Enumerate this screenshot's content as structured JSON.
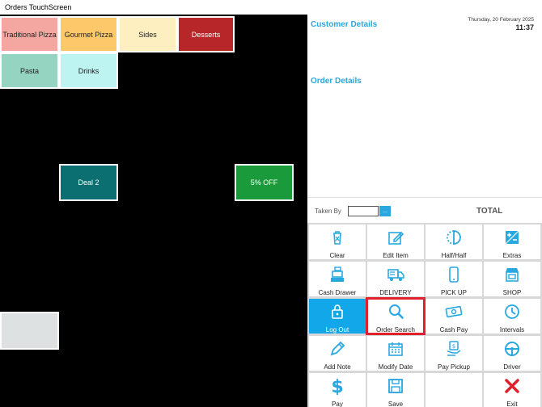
{
  "window": {
    "title": "Orders TouchScreen"
  },
  "categories": [
    {
      "label": "Traditional Pizza",
      "bg": "#f4a7a1",
      "text_light": false
    },
    {
      "label": "Gourmet Pizza",
      "bg": "#fcc86a",
      "text_light": false
    },
    {
      "label": "Sides",
      "bg": "#fdefc0",
      "text_light": false
    },
    {
      "label": "Desserts",
      "bg": "#b7272a",
      "text_light": true
    },
    {
      "label": "Pasta",
      "bg": "#96d4c2",
      "text_light": false
    },
    {
      "label": "Drinks",
      "bg": "#bdf3f0",
      "text_light": false
    }
  ],
  "deals": [
    {
      "label": "Deal 2",
      "bg": "#0b6f72"
    },
    {
      "label": "5% OFF",
      "bg": "#1a9a3b"
    },
    {
      "label": "",
      "bg": "#dde1e2"
    }
  ],
  "customer": {
    "title": "Customer Details"
  },
  "order": {
    "title": "Order Details"
  },
  "datetime": {
    "date": "Thursday, 20 February 2025",
    "time": "11:37"
  },
  "takenby": {
    "label": "Taken By",
    "value": "",
    "dropdown": "..."
  },
  "total": {
    "label": "TOTAL"
  },
  "colors": {
    "accent": "#29a8e0",
    "active_button": "#11a7e8",
    "highlight": "#e0202a"
  },
  "buttons": [
    {
      "label": "Clear",
      "icon": "trash-icon"
    },
    {
      "label": "Edit Item",
      "icon": "edit-icon"
    },
    {
      "label": "Half/Half",
      "icon": "half-circle-icon"
    },
    {
      "label": "Extras",
      "icon": "plus-minus-icon"
    },
    {
      "label": "Cash Drawer",
      "icon": "cash-register-icon"
    },
    {
      "label": "DELIVERY",
      "icon": "truck-icon"
    },
    {
      "label": "PICK UP",
      "icon": "phone-icon"
    },
    {
      "label": "SHOP",
      "icon": "shop-icon"
    },
    {
      "label": "Log Out",
      "icon": "lock-icon",
      "active": true
    },
    {
      "label": "Order Search",
      "icon": "search-icon",
      "highlight": true
    },
    {
      "label": "Cash Pay",
      "icon": "cash-icon"
    },
    {
      "label": "Intervals",
      "icon": "clock-icon"
    },
    {
      "label": "Add Note",
      "icon": "pencil-icon"
    },
    {
      "label": "Modify Date",
      "icon": "calendar-icon"
    },
    {
      "label": "Pay Pickup",
      "icon": "hand-money-icon"
    },
    {
      "label": "Driver",
      "icon": "steering-wheel-icon"
    },
    {
      "label": "Pay",
      "icon": "dollar-icon"
    },
    {
      "label": "Save",
      "icon": "save-icon"
    },
    {
      "label": "",
      "icon": ""
    },
    {
      "label": "Exit",
      "icon": "exit-icon"
    }
  ]
}
